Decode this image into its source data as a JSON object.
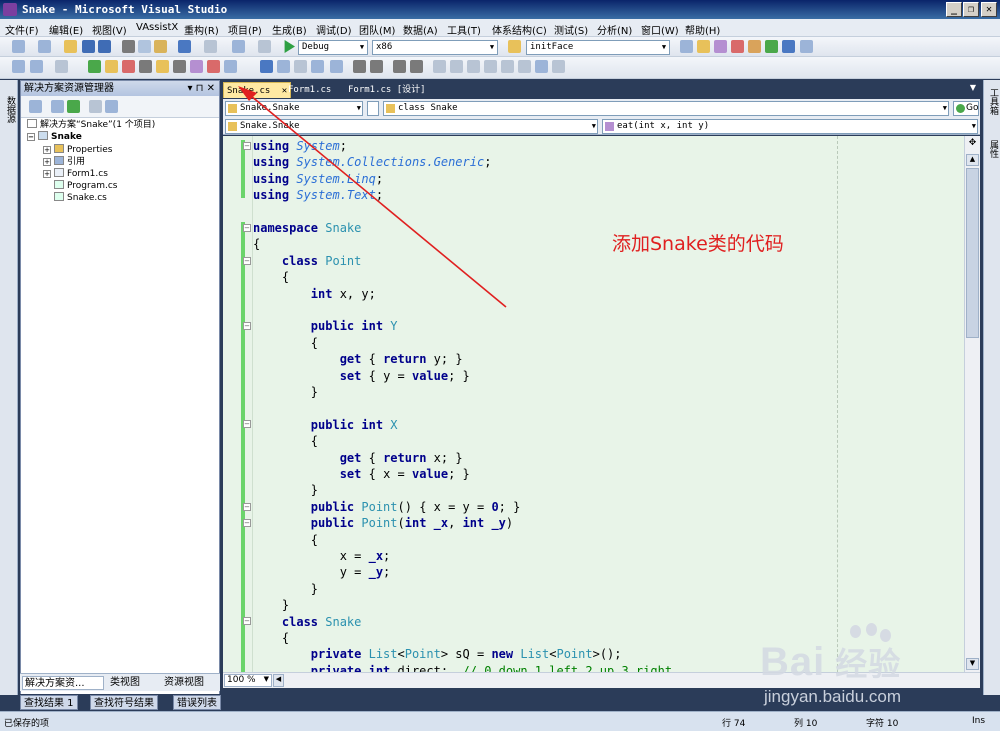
{
  "window": {
    "title": "Snake - Microsoft Visual Studio",
    "min_label": "_",
    "max_label": "❐",
    "close_label": "✕"
  },
  "menu": [
    "文件(F)",
    "编辑(E)",
    "视图(V)",
    "VAssistX",
    "重构(R)",
    "项目(P)",
    "生成(B)",
    "调试(D)",
    "团队(M)",
    "数据(A)",
    "工具(T)",
    "体系结构(C)",
    "测试(S)",
    "分析(N)",
    "窗口(W)",
    "帮助(H)"
  ],
  "toolbar": {
    "config": "Debug",
    "platform": "x86",
    "find": "initFace"
  },
  "left_strip": "数据源",
  "right_strip": [
    "工具箱",
    "属性"
  ],
  "solution_explorer": {
    "title": "解决方案资源管理器",
    "pin": "▾ ⊓ ✕",
    "root": "解决方案“Snake”(1 个项目)",
    "project": "Snake",
    "items": [
      "Properties",
      "引用",
      "Form1.cs",
      "Program.cs",
      "Snake.cs"
    ],
    "tabs": [
      "解决方案资...",
      "类视图",
      "资源视图"
    ]
  },
  "bottom_tabs": [
    "查找结果 1",
    "查找符号结果",
    "错误列表"
  ],
  "doc_tabs": [
    "Snake.cs",
    "Form1.cs",
    "Form1.cs [设计]"
  ],
  "nav": {
    "project_combo": "Snake.Snake",
    "class_combo": "class Snake",
    "go": "Go",
    "type_combo": "Snake.Snake",
    "member_combo": "eat(int x, int y)"
  },
  "code_lines": [
    [
      [
        "kw",
        "using"
      ],
      [
        "",
        ""
      ],
      [
        "it",
        " System"
      ],
      [
        "",
        ";"
      ]
    ],
    [
      [
        "kw",
        "using"
      ],
      [
        "it",
        " System"
      ],
      [
        "",
        ""
      ],
      [
        "",
        ""
      ],
      [
        "it",
        ".Collections"
      ],
      [
        "it",
        ".Generic"
      ],
      [
        "",
        ";"
      ]
    ],
    [
      [
        "kw",
        "using"
      ],
      [
        "it",
        " System"
      ],
      [
        "it",
        ".Linq"
      ],
      [
        "",
        ";"
      ]
    ],
    [
      [
        "kw",
        "using"
      ],
      [
        "it",
        " System"
      ],
      [
        "it",
        ".Text"
      ],
      [
        "",
        ";"
      ]
    ],
    [],
    [
      [
        "kw",
        "namespace"
      ],
      [
        "ty",
        " Snake"
      ]
    ],
    [
      [
        "",
        "{"
      ]
    ],
    [
      [
        "",
        "    "
      ],
      [
        "kw",
        "class"
      ],
      [
        "ty",
        " Point"
      ]
    ],
    [
      [
        "",
        "    {"
      ]
    ],
    [
      [
        "",
        "        "
      ],
      [
        "kw",
        "int"
      ],
      [
        "",
        " x, y;"
      ]
    ],
    [],
    [
      [
        "",
        "        "
      ],
      [
        "kw",
        "public int"
      ],
      [
        "ty",
        " Y"
      ]
    ],
    [
      [
        "",
        "        {"
      ]
    ],
    [
      [
        "",
        "            "
      ],
      [
        "kw",
        "get"
      ],
      [
        "",
        " { "
      ],
      [
        "kw",
        "return"
      ],
      [
        "",
        " y; }"
      ]
    ],
    [
      [
        "",
        "            "
      ],
      [
        "kw",
        "set"
      ],
      [
        "",
        " { y = "
      ],
      [
        "kw",
        "value"
      ],
      [
        "",
        ";"
      ],
      [
        "",
        " }"
      ]
    ],
    [
      [
        "",
        "        }"
      ]
    ],
    [],
    [
      [
        "",
        "        "
      ],
      [
        "kw",
        "public int"
      ],
      [
        "ty",
        " X"
      ]
    ],
    [
      [
        "",
        "        {"
      ]
    ],
    [
      [
        "",
        "            "
      ],
      [
        "kw",
        "get"
      ],
      [
        "",
        " { "
      ],
      [
        "kw",
        "return"
      ],
      [
        "",
        " x; }"
      ]
    ],
    [
      [
        "",
        "            "
      ],
      [
        "kw",
        "set"
      ],
      [
        "",
        " { x = "
      ],
      [
        "kw",
        "value"
      ],
      [
        "",
        ";"
      ],
      [
        "",
        " }"
      ]
    ],
    [
      [
        "",
        "        }"
      ]
    ],
    [
      [
        "",
        "        "
      ],
      [
        "kw",
        "public"
      ],
      [
        "ty",
        " Point"
      ],
      [
        "",
        "() { x = y = "
      ],
      [
        "kw",
        "0"
      ],
      [
        "",
        "; }"
      ]
    ],
    [
      [
        "",
        "        "
      ],
      [
        "kw",
        "public"
      ],
      [
        "ty",
        " Point"
      ],
      [
        "",
        "("
      ],
      [
        "kw",
        "int _x"
      ],
      [
        "",
        ", "
      ],
      [
        "kw",
        "int _y"
      ],
      [
        "",
        ")"
      ]
    ],
    [
      [
        "",
        "        {"
      ]
    ],
    [
      [
        "",
        "            x = "
      ],
      [
        "kw",
        "_x"
      ],
      [
        "",
        ";"
      ]
    ],
    [
      [
        "",
        "            y = "
      ],
      [
        "kw",
        "_y"
      ],
      [
        "",
        ";"
      ]
    ],
    [
      [
        "",
        "        }"
      ]
    ],
    [
      [
        "",
        "    }"
      ]
    ],
    [
      [
        "",
        "    "
      ],
      [
        "kw",
        "class"
      ],
      [
        "ty",
        " Snake"
      ]
    ],
    [
      [
        "",
        "    {"
      ]
    ],
    [
      [
        "",
        "        "
      ],
      [
        "kw",
        "private"
      ],
      [
        "ty",
        " List"
      ],
      [
        "",
        "<"
      ],
      [
        "ty",
        "Point"
      ],
      [
        "",
        "> sQ = "
      ],
      [
        "kw",
        "new"
      ],
      [
        "ty",
        " List"
      ],
      [
        "",
        "<"
      ],
      [
        "ty",
        "Point"
      ],
      [
        "",
        ">();"
      ]
    ],
    [
      [
        "",
        "        "
      ],
      [
        "kw",
        "private int"
      ],
      [
        "",
        " direct;  "
      ],
      [
        "cm",
        "// 0 down 1 left 2 up 3 right"
      ]
    ]
  ],
  "annotation": "添加Snake类的代码",
  "zoom": "100 %",
  "status": {
    "left": "已保存的项",
    "row_label": "行 74",
    "col_label": "列 10",
    "char_label": "字符 10",
    "mode": "Ins"
  },
  "watermark": {
    "brand": "Bai",
    "brand2": "经验",
    "url": "jingyan.baidu.com"
  },
  "colors": {
    "editor_bg": "#e8f4e8",
    "keyword": "#00008b",
    "type": "#2b91af",
    "annotation": "#e02020",
    "arrow": "#e02020"
  }
}
